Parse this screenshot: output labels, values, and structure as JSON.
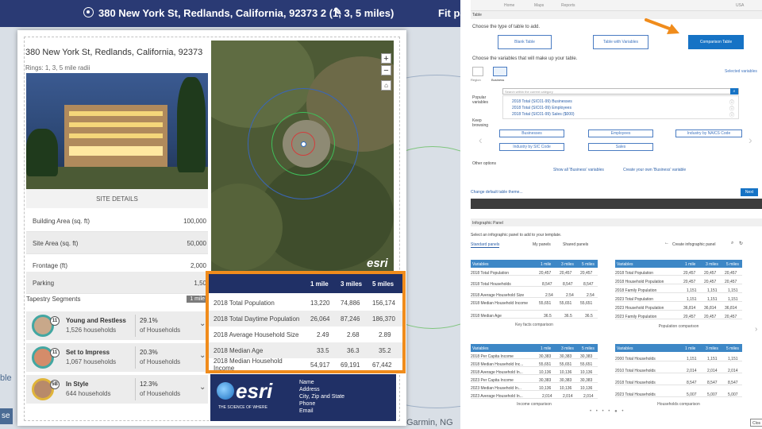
{
  "left": {
    "topbar": {
      "title": "380 New York St, Redlands, California, 92373 2 (1, 3, 5 miles)",
      "fit": "Fit pag"
    },
    "edge_text": "ble",
    "edge_button": "se",
    "attribution": "Garmin, NG",
    "report": {
      "address": "380 New York St, Redlands, California, 92373",
      "rings": "Rings: 1, 3, 5 mile radii",
      "site_details_label": "SITE DETAILS",
      "details": [
        {
          "label": "Building Area (sq. ft)",
          "value": "100,000"
        },
        {
          "label": "Site Area (sq. ft)",
          "value": "50,000"
        },
        {
          "label": "Frontage (ft)",
          "value": "2,000"
        },
        {
          "label": "Parking",
          "value": "1,50"
        }
      ],
      "tapestry_label": "Tapestry Segments",
      "tapestry_badge": "1 mile",
      "segments": [
        {
          "code": "11",
          "name": "Young and Restless",
          "households": "1,526 households",
          "percent": "29.1%",
          "of": "of Households"
        },
        {
          "code": "11",
          "name": "Set to Impress",
          "households": "1,067 households",
          "percent": "20.3%",
          "of": "of Households"
        },
        {
          "code": "5B",
          "name": "In Style",
          "households": "644 households",
          "percent": "12.3%",
          "of": "of Households"
        }
      ],
      "map_logo": "esri",
      "key_facts": {
        "headers": [
          "1 mile",
          "3 miles",
          "5 miles"
        ],
        "rows": [
          {
            "label": "2018 Total Population",
            "v1": "13,220",
            "v3": "74,886",
            "v5": "156,174"
          },
          {
            "label": "2018 Total Daytime Population",
            "v1": "26,064",
            "v3": "87,246",
            "v5": "186,370"
          },
          {
            "label": "2018 Average Household Size",
            "v1": "2.49",
            "v3": "2.68",
            "v5": "2.89"
          },
          {
            "label": "2018 Median Age",
            "v1": "33.5",
            "v3": "36.3",
            "v5": "35.2"
          },
          {
            "label": "2018 Median Household Income",
            "v1": "54,917",
            "v3": "69,191",
            "v5": "67,442"
          }
        ]
      },
      "footer": {
        "logo": "esri",
        "tagline": "THE SCIENCE OF WHERE",
        "contact": [
          "Name",
          "Address",
          "City, Zip and State",
          "Phone",
          "Email"
        ]
      }
    }
  },
  "right_top": {
    "nav": [
      "Home",
      "Maps",
      "Reports"
    ],
    "locale": "USA",
    "header": "Table",
    "prompt_type": "Choose the type of table to add.",
    "buttons": {
      "blank": "Blank Table",
      "variables": "Table with Variables",
      "comparison": "Comparison Table"
    },
    "prompt_vars": "Choose the variables that will make up your table.",
    "selected_label": "Selected variables",
    "tabs": {
      "region": "Region",
      "business": "Business"
    },
    "search_placeholder": "Search within the current category",
    "popular_label": "Popular variables",
    "popular": [
      "2018 Total (SIC01-99) Businesses",
      "2018 Total (SIC01-99) Employees",
      "2018 Total (SIC01-99) Sales ($000)"
    ],
    "keep_label": "Keep browsing",
    "categories": [
      "Businesses",
      "Employees",
      "Industry by NAICS Code",
      "Industry by SIC Code",
      "Sales"
    ],
    "other_label": "Other options",
    "show_all": "Show all 'Business' variables",
    "create_own": "Create your own 'Business' variable",
    "change_theme": "Change default table theme...",
    "next": "Next"
  },
  "right_bottom": {
    "header": "Infographic Panel",
    "prompt": "Select an infographic panel to add to your template.",
    "tabs": [
      "Standard panels",
      "My panels",
      "Shared panels"
    ],
    "create": "Create infographic panel",
    "panels": [
      {
        "caption": "Key facts comparison",
        "headers": [
          "Variables",
          "1 mile",
          "3 miles",
          "5 miles"
        ],
        "rows": [
          [
            "2018 Total Population",
            "20,457",
            "20,457",
            "20,457"
          ],
          [
            "2018 Total Households",
            "8,547",
            "8,547",
            "8,547"
          ],
          [
            "2018 Average Household Size",
            "2.54",
            "2.54",
            "2.54"
          ],
          [
            "2018 Median Household Income",
            "55,651",
            "55,651",
            "55,651"
          ],
          [
            "2018 Median Age",
            "36.5",
            "36.5",
            "36.5"
          ]
        ]
      },
      {
        "caption": "Population comparison",
        "headers": [
          "Variables",
          "1 mile",
          "3 miles",
          "5 miles"
        ],
        "rows": [
          [
            "2018 Total Population",
            "20,457",
            "20,457",
            "20,457"
          ],
          [
            "2018 Household Population",
            "20,457",
            "20,457",
            "20,457"
          ],
          [
            "2018 Family Population",
            "1,151",
            "1,151",
            "1,151"
          ],
          [
            "2023 Total Population",
            "1,151",
            "1,151",
            "1,151"
          ],
          [
            "2023 Household Population",
            "36,814",
            "36,814",
            "36,814"
          ],
          [
            "2023 Family Population",
            "20,457",
            "20,457",
            "20,457"
          ]
        ]
      },
      {
        "caption": "Income comparison",
        "headers": [
          "Variables",
          "1 mile",
          "3 miles",
          "5 miles"
        ],
        "rows": [
          [
            "2018 Per Capita Income",
            "30,383",
            "30,383",
            "30,383"
          ],
          [
            "2018 Median Household Inc...",
            "55,651",
            "55,651",
            "55,651"
          ],
          [
            "2018 Average Household In...",
            "10,136",
            "10,136",
            "10,136"
          ],
          [
            "2023 Per Capita Income",
            "30,383",
            "30,383",
            "30,383"
          ],
          [
            "2023 Median Household In...",
            "10,136",
            "10,136",
            "10,136"
          ],
          [
            "2023 Average Household In...",
            "2,014",
            "2,014",
            "2,014"
          ]
        ]
      },
      {
        "caption": "Households comparison",
        "headers": [
          "Variables",
          "1 mile",
          "3 miles",
          "5 miles"
        ],
        "rows": [
          [
            "2000 Total Households",
            "1,151",
            "1,151",
            "1,151"
          ],
          [
            "2010 Total Households",
            "2,014",
            "2,014",
            "2,014"
          ],
          [
            "2018 Total Households",
            "8,547",
            "8,547",
            "8,547"
          ],
          [
            "2023 Total Households",
            "5,007",
            "5,007",
            "5,007"
          ]
        ]
      }
    ],
    "close": "Clos"
  },
  "colors": {
    "navy": "#203066",
    "orange": "#f08c1c",
    "blue": "#1673c5",
    "teal": "#43a7a2"
  }
}
